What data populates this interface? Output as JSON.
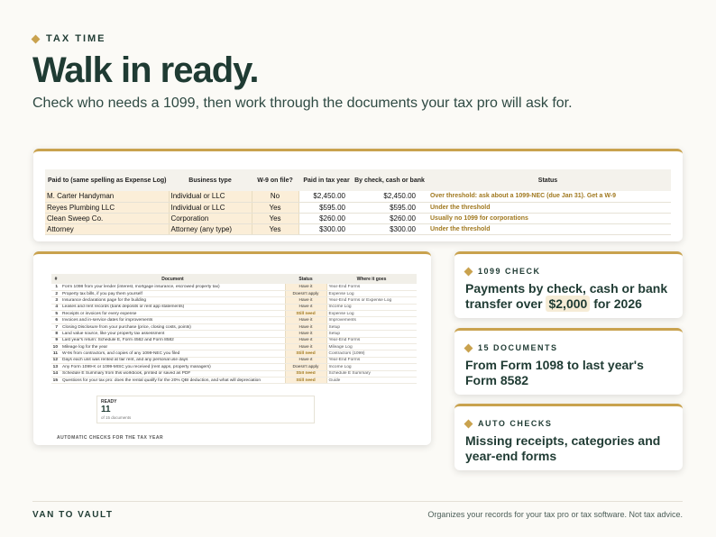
{
  "header": {
    "eyebrow": "TAX TIME",
    "title": "Walk in ready.",
    "subtitle": "Check who needs a 1099, then work through the documents your tax pro will ask for."
  },
  "contractor_table": {
    "columns": [
      "Paid to (same spelling as Expense Log)",
      "Business type",
      "W-9 on file?",
      "Paid in tax year",
      "By check, cash or bank",
      "Status"
    ],
    "rows": [
      {
        "payee": "M. Carter Handyman",
        "type": "Individual or LLC",
        "w9": "No",
        "paid": "$2,450.00",
        "by_check": "$2,450.00",
        "status": "Over threshold: ask about a 1099-NEC (due Jan 31). Get a W-9"
      },
      {
        "payee": "Reyes Plumbing LLC",
        "type": "Individual or LLC",
        "w9": "Yes",
        "paid": "$595.00",
        "by_check": "$595.00",
        "status": "Under the threshold"
      },
      {
        "payee": "Clean Sweep Co.",
        "type": "Corporation",
        "w9": "Yes",
        "paid": "$260.00",
        "by_check": "$260.00",
        "status": "Usually no 1099 for corporations"
      },
      {
        "payee": "Attorney",
        "type": "Attorney (any type)",
        "w9": "Yes",
        "paid": "$300.00",
        "by_check": "$300.00",
        "status": "Under the threshold"
      }
    ]
  },
  "documents_table": {
    "columns": [
      "#",
      "Document",
      "Status",
      "Where it goes"
    ],
    "rows": [
      {
        "n": "1",
        "doc": "Form 1098 from your lender (interest, mortgage insurance, escrowed property tax)",
        "status": "Have it",
        "where": "Year-End Forms"
      },
      {
        "n": "2",
        "doc": "Property tax bills, if you pay them yourself",
        "status": "Doesn't apply",
        "where": "Expense Log"
      },
      {
        "n": "3",
        "doc": "Insurance declarations page for the building",
        "status": "Have it",
        "where": "Year-End Forms or Expense Log"
      },
      {
        "n": "4",
        "doc": "Leases and rent records (bank deposits or rent app statements)",
        "status": "Have it",
        "where": "Income Log"
      },
      {
        "n": "5",
        "doc": "Receipts or invoices for every expense",
        "status": "Still need",
        "where": "Expense Log"
      },
      {
        "n": "6",
        "doc": "Invoices and in-service dates for improvements",
        "status": "Have it",
        "where": "Improvements"
      },
      {
        "n": "7",
        "doc": "Closing Disclosure from your purchase (price, closing costs, points)",
        "status": "Have it",
        "where": "Setup"
      },
      {
        "n": "8",
        "doc": "Land value source, like your property tax assessment",
        "status": "Have it",
        "where": "Setup"
      },
      {
        "n": "9",
        "doc": "Last year's return: Schedule E, Form 4562 and Form 8582",
        "status": "Have it",
        "where": "Year-End Forms"
      },
      {
        "n": "10",
        "doc": "Mileage log for the year",
        "status": "Have it",
        "where": "Mileage Log"
      },
      {
        "n": "11",
        "doc": "W-9s from contractors, and copies of any 1099-NEC you filed",
        "status": "Still need",
        "where": "Contractors (1099)"
      },
      {
        "n": "12",
        "doc": "Days each unit was rented at fair rent, and any personal use days",
        "status": "Have it",
        "where": "Year-End Forms"
      },
      {
        "n": "13",
        "doc": "Any Form 1099-K or 1099-MISC you received (rent apps, property managers)",
        "status": "Doesn't apply",
        "where": "Income Log"
      },
      {
        "n": "14",
        "doc": "Schedule E Summary from this workbook, printed or saved as PDF",
        "status": "Still need",
        "where": "Schedule E Summary"
      },
      {
        "n": "15",
        "doc": "Questions for your tax pro: does the rental qualify for the 20% QBI deduction, and what will depreciation",
        "status": "Still need",
        "where": "Guide"
      }
    ],
    "ready_label": "READY",
    "ready_count": "11",
    "ready_of": "of 15 documents",
    "cutoff_text": "AUTOMATIC CHECKS FOR THE TAX YEAR"
  },
  "cards": [
    {
      "eyebrow": "1099 CHECK",
      "pre": "Payments by check, cash or bank transfer over ",
      "highlight": "$2,000",
      "post": " for 2026"
    },
    {
      "eyebrow": "15 DOCUMENTS",
      "text": "From Form 1098 to last year's Form 8582"
    },
    {
      "eyebrow": "AUTO CHECKS",
      "text": "Missing receipts, categories and year-end forms"
    }
  ],
  "footer": {
    "brand": "VAN TO VAULT",
    "disclaimer": "Organizes your records for your tax pro or tax software. Not tax advice."
  },
  "colors": {
    "accent": "#c9a24e",
    "text": "#1f3b33",
    "highlight_bg": "#fbeed8"
  }
}
